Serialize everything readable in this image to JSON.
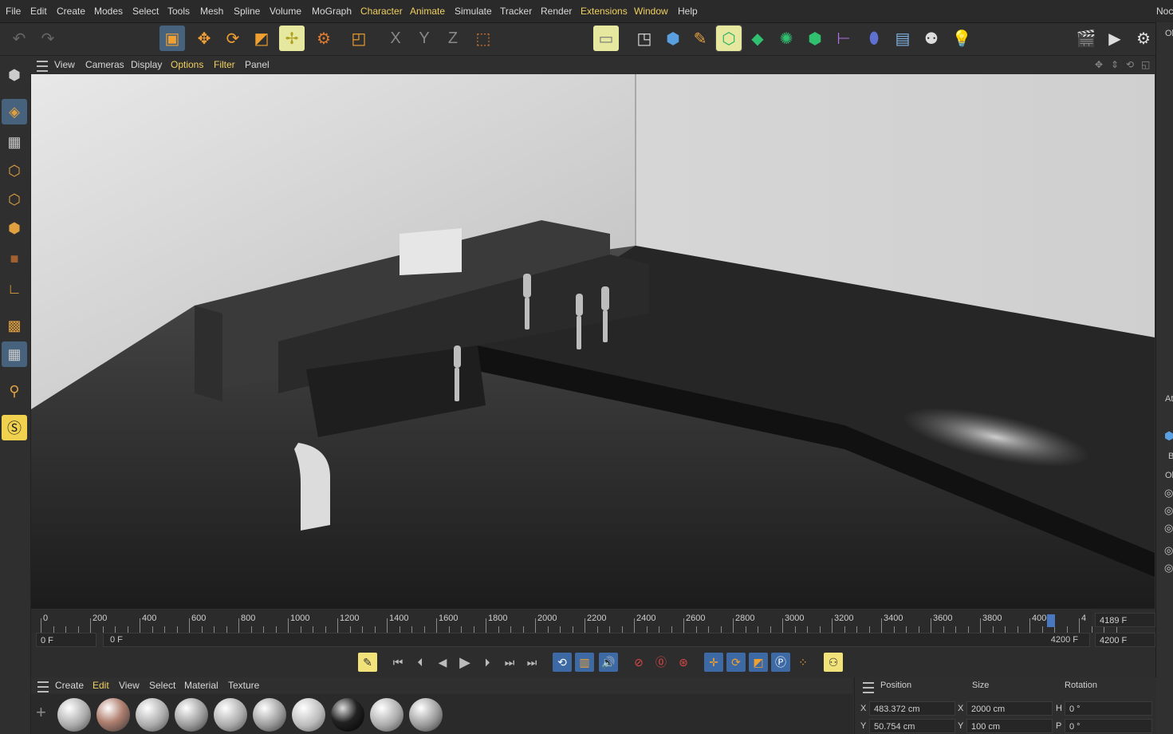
{
  "menubar": {
    "items": [
      "File",
      "Edit",
      "Create",
      "Modes",
      "Select",
      "Tools",
      "Mesh",
      "Spline",
      "Volume",
      "MoGraph",
      "Character",
      "Animate",
      "Simulate",
      "Tracker",
      "Render",
      "Extensions",
      "Window",
      "Help"
    ],
    "right_label": "Noc"
  },
  "viewport_menu": {
    "items": [
      "View",
      "Cameras",
      "Display",
      "Options",
      "Filter",
      "Panel"
    ]
  },
  "timeline": {
    "ticks": [
      "0",
      "200",
      "400",
      "600",
      "800",
      "1000",
      "1200",
      "1400",
      "1600",
      "1800",
      "2000",
      "2200",
      "2400",
      "2600",
      "2800",
      "3000",
      "3200",
      "3400",
      "3600",
      "3800",
      "4000",
      "4"
    ],
    "current_frame": "4189 F",
    "start_field": "0 F",
    "range_start": "0 F",
    "range_end": "4200 F",
    "end_field": "4200 F"
  },
  "material_manager": {
    "menu": [
      "Create",
      "Edit",
      "View",
      "Select",
      "Material",
      "Texture"
    ]
  },
  "attributes": {
    "headers": [
      "Position",
      "Size",
      "Rotation"
    ],
    "rows": [
      {
        "axis": "X",
        "position": "483.372 cm",
        "size_axis": "X",
        "size": "2000 cm",
        "rot_axis": "H",
        "rotation": "0 °"
      },
      {
        "axis": "Y",
        "position": "50.754 cm",
        "size_axis": "Y",
        "size": "100 cm",
        "rot_axis": "P",
        "rotation": "0 °"
      }
    ]
  },
  "right_strip": {
    "labels": [
      "Ol",
      "At",
      "B",
      "Ol"
    ]
  },
  "colors": {
    "accent_yellow": "#f0d060",
    "selected_blue": "#47627c",
    "highlight_yellow": "#e6e8a0"
  }
}
